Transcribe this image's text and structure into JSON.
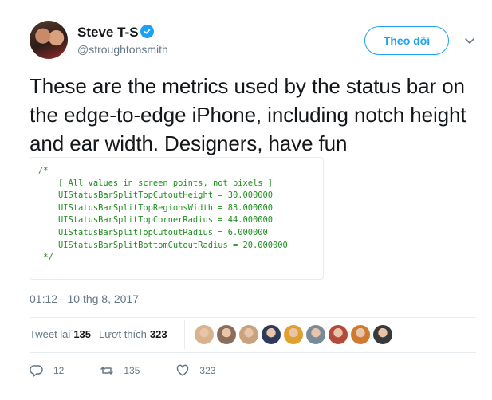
{
  "author": {
    "name": "Steve T-S",
    "handle": "@stroughtonsmith"
  },
  "follow_label": "Theo dõi",
  "text": "These are the metrics used by the status bar on the edge-to-edge iPhone, including notch height and ear width. Designers, have fun",
  "code_lines": [
    "/*",
    "    [ All values in screen points, not pixels ]",
    "",
    "    UIStatusBarSplitTopCutoutHeight = 30.000000",
    "    UIStatusBarSplitTopRegionsWidth = 83.000000",
    "    UIStatusBarSplitTopCornerRadius = 44.000000",
    "    UIStatusBarSplitTopCutoutRadius = 6.000000",
    "    UIStatusBarSplitBottomCutoutRadius = 20.000000",
    " */"
  ],
  "timestamp": "01:12 - 10 thg 8, 2017",
  "stats": {
    "retweets_label": "Tweet lại",
    "retweets": "135",
    "likes_label": "Lượt thích",
    "likes": "323"
  },
  "likers_colors": [
    "#d9b38c",
    "#8a6d5a",
    "#c9a27e",
    "#2e3a59",
    "#e0a030",
    "#7b8a99",
    "#b34a3a",
    "#d07a30",
    "#3a3a3a"
  ],
  "actions": {
    "replies": "12",
    "retweets": "135",
    "likes": "323"
  },
  "colors": {
    "accent": "#1da1f2",
    "code": "#1f8f1f",
    "muted": "#657786"
  }
}
